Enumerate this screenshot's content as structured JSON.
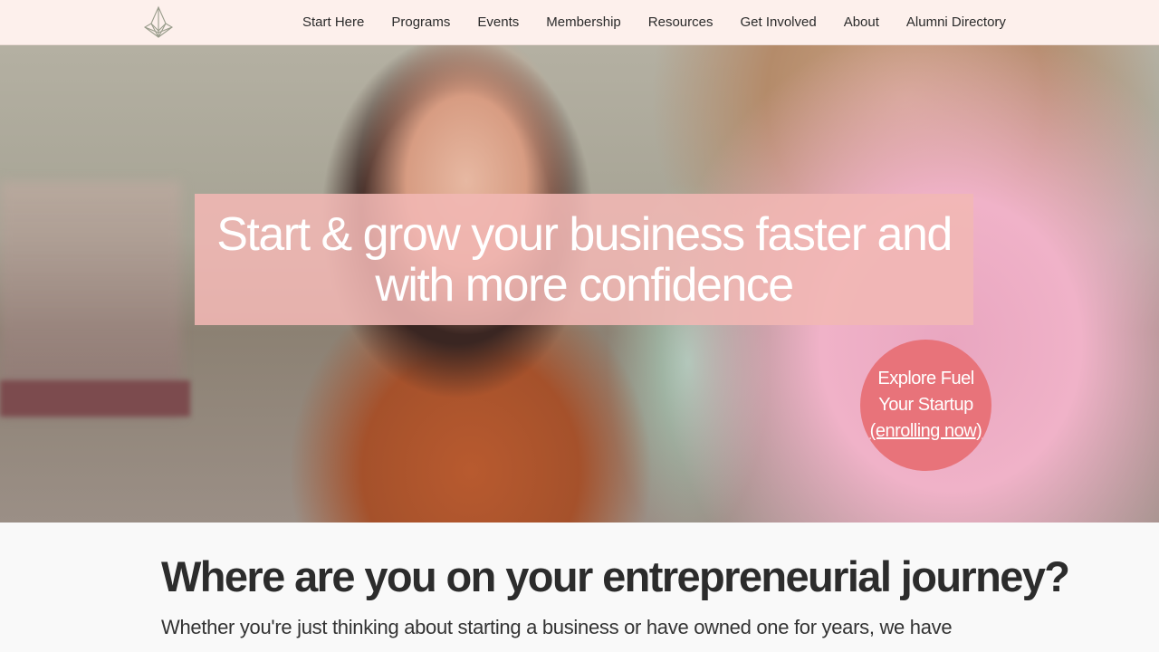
{
  "nav": {
    "logo_icon": "lotus-logo-icon",
    "items": [
      {
        "label": "Start Here"
      },
      {
        "label": "Programs"
      },
      {
        "label": "Events"
      },
      {
        "label": "Membership"
      },
      {
        "label": "Resources"
      },
      {
        "label": "Get Involved"
      },
      {
        "label": "About"
      },
      {
        "label": "Alumni Directory"
      }
    ]
  },
  "hero": {
    "title": "Start & grow your business faster and with more confidence",
    "cta": {
      "line1": "Explore Fuel",
      "line2": "Your Startup",
      "link": "(enrolling now)"
    },
    "colors": {
      "title_box": "#f1b7b4",
      "cta": "#e8737a"
    }
  },
  "section": {
    "title": "Where are you on your entrepreneurial journey?",
    "body": "Whether you're just thinking about starting a business or have owned one for years, we have"
  },
  "colors": {
    "topbar": "#fdf0ec",
    "text": "#2b2b2b"
  }
}
